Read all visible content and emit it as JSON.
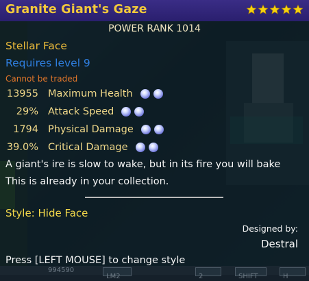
{
  "tooltip": {
    "title": "Granite Giant's Gaze",
    "star_count": 5,
    "star_color": "#f5d20f",
    "power_rank": "POWER RANK 1014",
    "item_type": "Stellar Face",
    "requirement": "Requires level 9",
    "trade_status": "Cannot be traded",
    "stats": [
      {
        "value": "13955",
        "name": "Maximum Health",
        "gems": 2
      },
      {
        "value": "29%",
        "name": "Attack Speed",
        "gems": 2
      },
      {
        "value": "1794",
        "name": "Physical Damage",
        "gems": 2
      },
      {
        "value": "39.0%",
        "name": "Critical Damage",
        "gems": 2
      }
    ],
    "flavor_text": "A giant's ire is slow to wake, but in its fire you will bake",
    "collection_note": "This is already in your collection.",
    "style_label": "Style: Hide Face",
    "designed_by_label": "Designed by:",
    "designer": "Destral",
    "hint": "Press [LEFT MOUSE] to change style"
  },
  "hud": {
    "items": [
      "994590",
      "LM2",
      "2",
      "SHIFT",
      "H"
    ]
  },
  "colors": {
    "title_bar": "#2f2378",
    "title_text": "#f2c93b",
    "item_type": "#e9b93a",
    "requirement": "#2f7fe0",
    "trade_status": "#e2762a",
    "stat_text": "#f0d889",
    "style_text": "#f2d84a"
  }
}
